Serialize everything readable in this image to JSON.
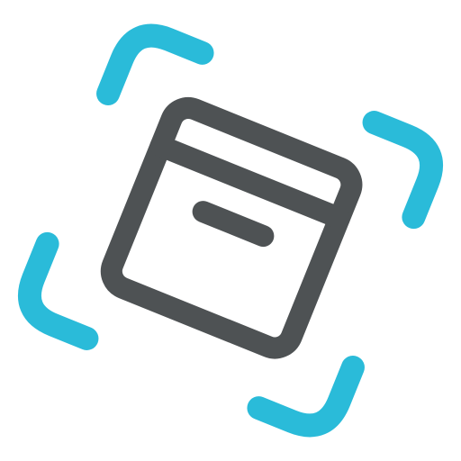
{
  "icon": {
    "name": "scan-archive-box-icon",
    "colors": {
      "frame": "#2ABBD9",
      "box": "#4E5254",
      "background": "#FFFFFF"
    }
  }
}
